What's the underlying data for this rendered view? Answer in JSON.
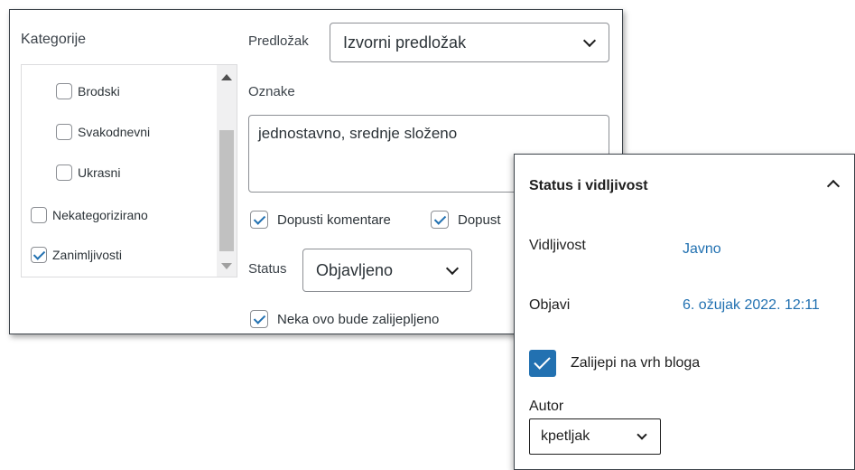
{
  "categories": {
    "title": "Kategorije",
    "items": [
      {
        "label": "Brodski",
        "checked": false
      },
      {
        "label": "Svakodnevni",
        "checked": false
      },
      {
        "label": "Ukrasni",
        "checked": false
      },
      {
        "label": "Nekategorizirano",
        "checked": false
      },
      {
        "label": "Zanimljivosti",
        "checked": true
      }
    ]
  },
  "template": {
    "label": "Predložak",
    "value": "Izvorni predložak"
  },
  "tags": {
    "label": "Oznake",
    "value": "jednostavno, srednje složeno"
  },
  "options": {
    "allow_comments": {
      "label": "Dopusti komentare",
      "checked": true
    },
    "allow_pings": {
      "label": "Dopust",
      "checked": true
    },
    "sticky": {
      "label": "Neka ovo bude zalijepljeno",
      "checked": true
    }
  },
  "status": {
    "label": "Status",
    "value": "Objavljeno"
  },
  "status_panel": {
    "title": "Status i vidljivost",
    "visibility_label": "Vidljivost",
    "visibility_value": "Javno",
    "publish_label": "Objavi",
    "publish_value": "6. ožujak 2022. 12:11",
    "stick_label": "Zalijepi na vrh bloga",
    "stick_checked": true,
    "author_label": "Autor",
    "author_value": "kpetljak"
  },
  "colors": {
    "accent": "#2271b1",
    "border": "#8c8f94",
    "text": "#1e1e1e"
  }
}
